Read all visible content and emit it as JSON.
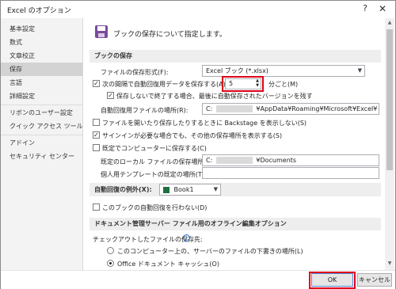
{
  "window": {
    "title": "Excel のオプション",
    "help_glyph": "?",
    "close_glyph": "✕"
  },
  "sidebar": {
    "items": [
      {
        "label": "基本設定"
      },
      {
        "label": "数式"
      },
      {
        "label": "文章校正"
      },
      {
        "label": "保存",
        "selected": true
      },
      {
        "label": "言語"
      },
      {
        "label": "詳細設定"
      },
      {
        "label": "リボンのユーザー設定"
      },
      {
        "label": "クイック アクセス ツール バー"
      },
      {
        "label": "アドイン"
      },
      {
        "label": "セキュリティ センター"
      }
    ]
  },
  "main": {
    "header_icon": "save-icon",
    "header_text": "ブックの保存について指定します。",
    "save_section": {
      "title": "ブックの保存",
      "format_label": "ファイルの保存形式(F):",
      "format_value": "Excel ブック (*.xlsx)",
      "autorecover_label": "次の間隔で自動回復用データを保存する(A):",
      "autorecover_checked": true,
      "autorecover_minutes": "5",
      "minutes_suffix": "分ごと(M)",
      "keep_last_label": "保存しないで終了する場合、最後に自動保存されたバージョンを残す",
      "keep_last_checked": true,
      "autorecover_location_label": "自動回復用ファイルの場所(R):",
      "autorecover_location_prefix": "C:",
      "autorecover_location_value": "¥AppData¥Roaming¥Microsoft¥Excel¥",
      "backstage_label": "ファイルを開いたり保存したりするときに Backstage を表示しない(S)",
      "backstage_checked": false,
      "signin_label": "サインインが必要な場合でも、その他の保存場所を表示する(S)",
      "signin_checked": true,
      "default_computer_label": "既定でコンピューターに保存する(C)",
      "default_computer_checked": false,
      "default_local_label": "既定のローカル ファイルの保存場所(I):",
      "default_local_prefix": "C:",
      "default_local_value": "¥Documents",
      "template_label": "個人用テンプレートの既定の場所(T):",
      "template_value": ""
    },
    "exception_section": {
      "title": "自動回復の例外(X):",
      "book_value": "Book1",
      "disable_label": "このブックの自動回復を行わない(D)",
      "disable_checked": false
    },
    "offline_section": {
      "title": "ドキュメント管理サーバー ファイル用のオフライン編集オプション",
      "checkout_label": "チェックアウトしたファイルの保存先:",
      "info_icon": "info-icon",
      "option1_label": "このコンピューター上の、サーバーのファイルの下書きの場所(L)",
      "option1_selected": false,
      "option2_label": "Office ドキュメント キャッシュ(O)",
      "option2_selected": true
    }
  },
  "footer": {
    "ok_label": "OK",
    "cancel_label": "キャンセル"
  },
  "colors": {
    "highlight": "#e0001a",
    "selected_nav": "#d3d3d3",
    "section_bg": "#eeeeee",
    "excel_green": "#1d6f42"
  }
}
